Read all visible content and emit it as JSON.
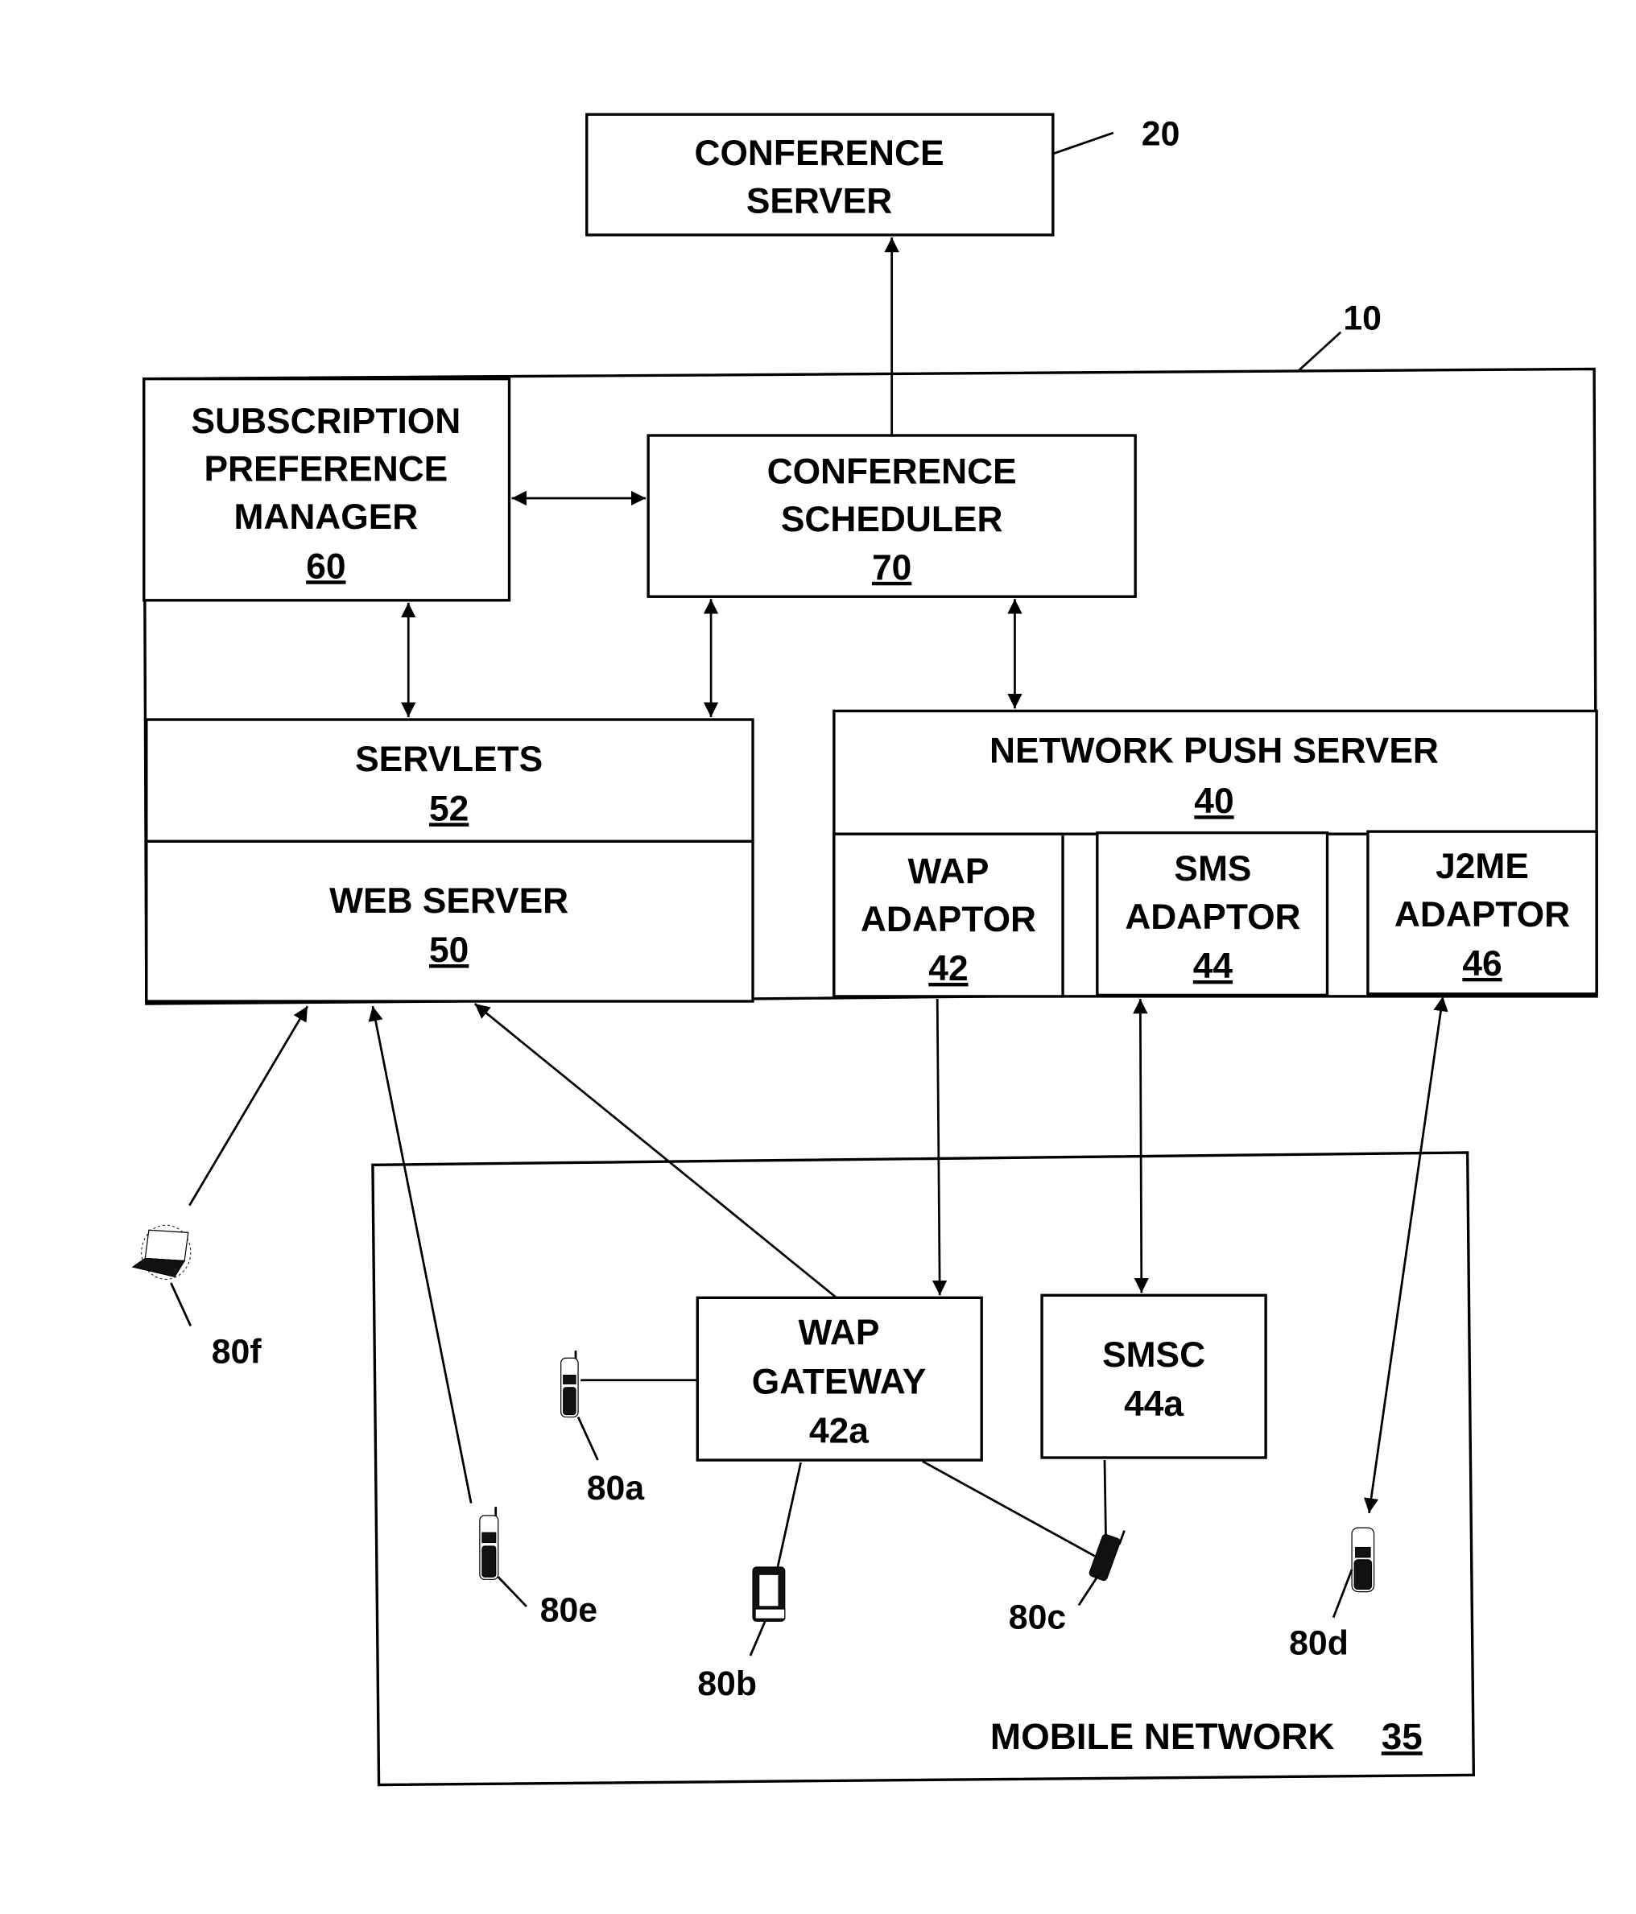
{
  "figure": {
    "conference_server": {
      "lines": [
        "CONFERENCE",
        "SERVER"
      ],
      "ref": "20"
    },
    "system": {
      "ref": "10"
    },
    "subscription_preference_manager": {
      "lines": [
        "SUBSCRIPTION",
        "PREFERENCE",
        "MANAGER"
      ],
      "ref": "60"
    },
    "conference_scheduler": {
      "lines": [
        "CONFERENCE",
        "SCHEDULER"
      ],
      "ref": "70"
    },
    "servlets": {
      "lines": [
        "SERVLETS"
      ],
      "ref": "52"
    },
    "web_server": {
      "lines": [
        "WEB SERVER"
      ],
      "ref": "50"
    },
    "network_push_server": {
      "lines": [
        "NETWORK PUSH SERVER"
      ],
      "ref": "40"
    },
    "wap_adaptor": {
      "lines": [
        "WAP",
        "ADAPTOR"
      ],
      "ref": "42"
    },
    "sms_adaptor": {
      "lines": [
        "SMS",
        "ADAPTOR"
      ],
      "ref": "44"
    },
    "j2me_adaptor": {
      "lines": [
        "J2ME",
        "ADAPTOR"
      ],
      "ref": "46"
    },
    "wap_gateway": {
      "lines": [
        "WAP",
        "GATEWAY",
        "42a"
      ]
    },
    "smsc": {
      "lines": [
        "SMSC",
        "44a"
      ]
    },
    "mobile_network": {
      "label": "MOBILE NETWORK",
      "ref": "35"
    },
    "devices": [
      {
        "id": "80a",
        "icon": "mobile-phone-icon"
      },
      {
        "id": "80b",
        "icon": "pda-icon"
      },
      {
        "id": "80c",
        "icon": "flip-phone-icon"
      },
      {
        "id": "80d",
        "icon": "mobile-phone-icon"
      },
      {
        "id": "80e",
        "icon": "mobile-phone-icon"
      },
      {
        "id": "80f",
        "icon": "laptop-icon"
      }
    ]
  }
}
